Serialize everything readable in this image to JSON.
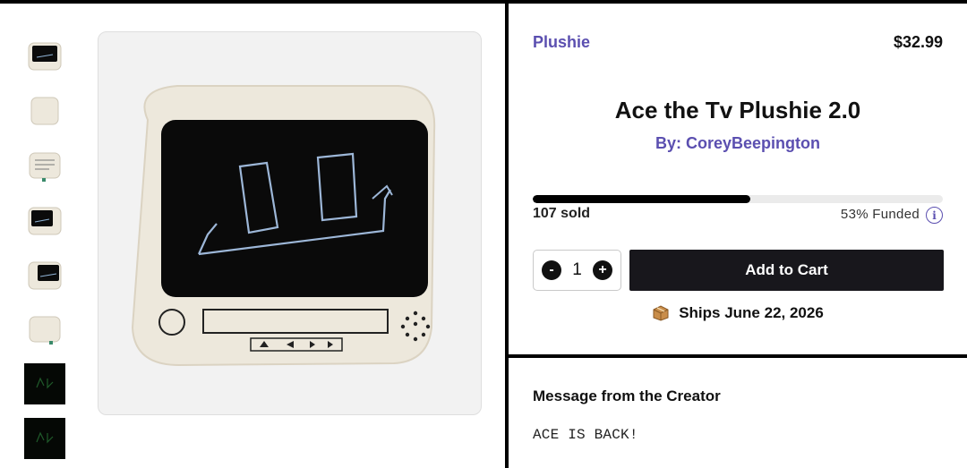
{
  "product": {
    "category": "Plushie",
    "price": "$32.99",
    "title": "Ace the Tv Plushie 2.0",
    "creator": "By: CoreyBeepington",
    "funded_fraction": 0.53,
    "sold": "107 sold",
    "funded": "53% Funded",
    "info_icon": "info-icon",
    "ships": "Ships June 22, 2026",
    "ships_icon": "package-icon"
  },
  "cart": {
    "quantity": "1",
    "minus_label": "-",
    "plus_label": "+",
    "add_label": "Add to Cart"
  },
  "message": {
    "title": "Message from the Creator",
    "body": "ACE IS BACK!"
  },
  "gallery": {
    "thumbnail_count": 8,
    "colors": {
      "accent": "#5b4fb0",
      "button": "#18171c",
      "plush": "#ede8dc"
    }
  }
}
